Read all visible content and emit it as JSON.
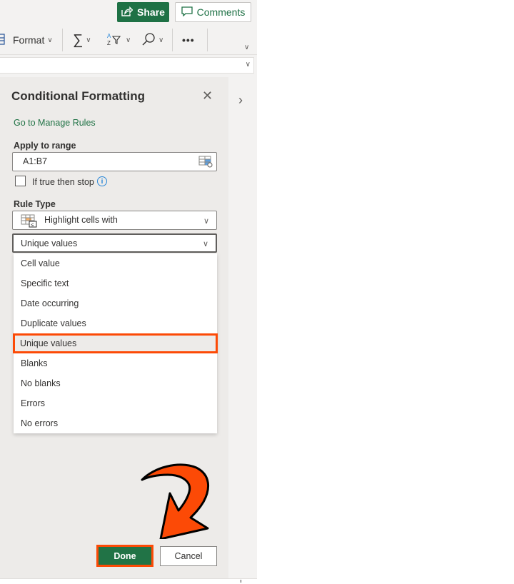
{
  "topbar": {
    "share_label": "Share",
    "comments_label": "Comments"
  },
  "ribbon": {
    "format_label": "Format",
    "icons": [
      "format-cells-icon",
      "autosum-icon",
      "sort-filter-icon",
      "find-icon",
      "more-options-icon",
      "ribbon-collapse-icon"
    ]
  },
  "pane": {
    "title": "Conditional Formatting",
    "manage_rules_link": "Go to Manage Rules",
    "apply_to_range_label": "Apply to range",
    "apply_to_range_value": "A1:B7",
    "stop_if_true_label": "If true then stop",
    "stop_if_true_checked": false,
    "rule_type_label": "Rule Type",
    "rule_type_value": "Highlight cells with",
    "condition_value": "Unique values",
    "condition_options": [
      "Cell value",
      "Specific text",
      "Date occurring",
      "Duplicate values",
      "Unique values",
      "Blanks",
      "No blanks",
      "Errors",
      "No errors"
    ],
    "highlighted_option": "Unique values",
    "done_label": "Done",
    "cancel_label": "Cancel"
  },
  "annotation": {
    "highlight_color": "#fc4a06",
    "arrow": "curved-arrow-pointing-to-done"
  },
  "colors": {
    "brand_green": "#217346",
    "link_green": "#217346"
  }
}
